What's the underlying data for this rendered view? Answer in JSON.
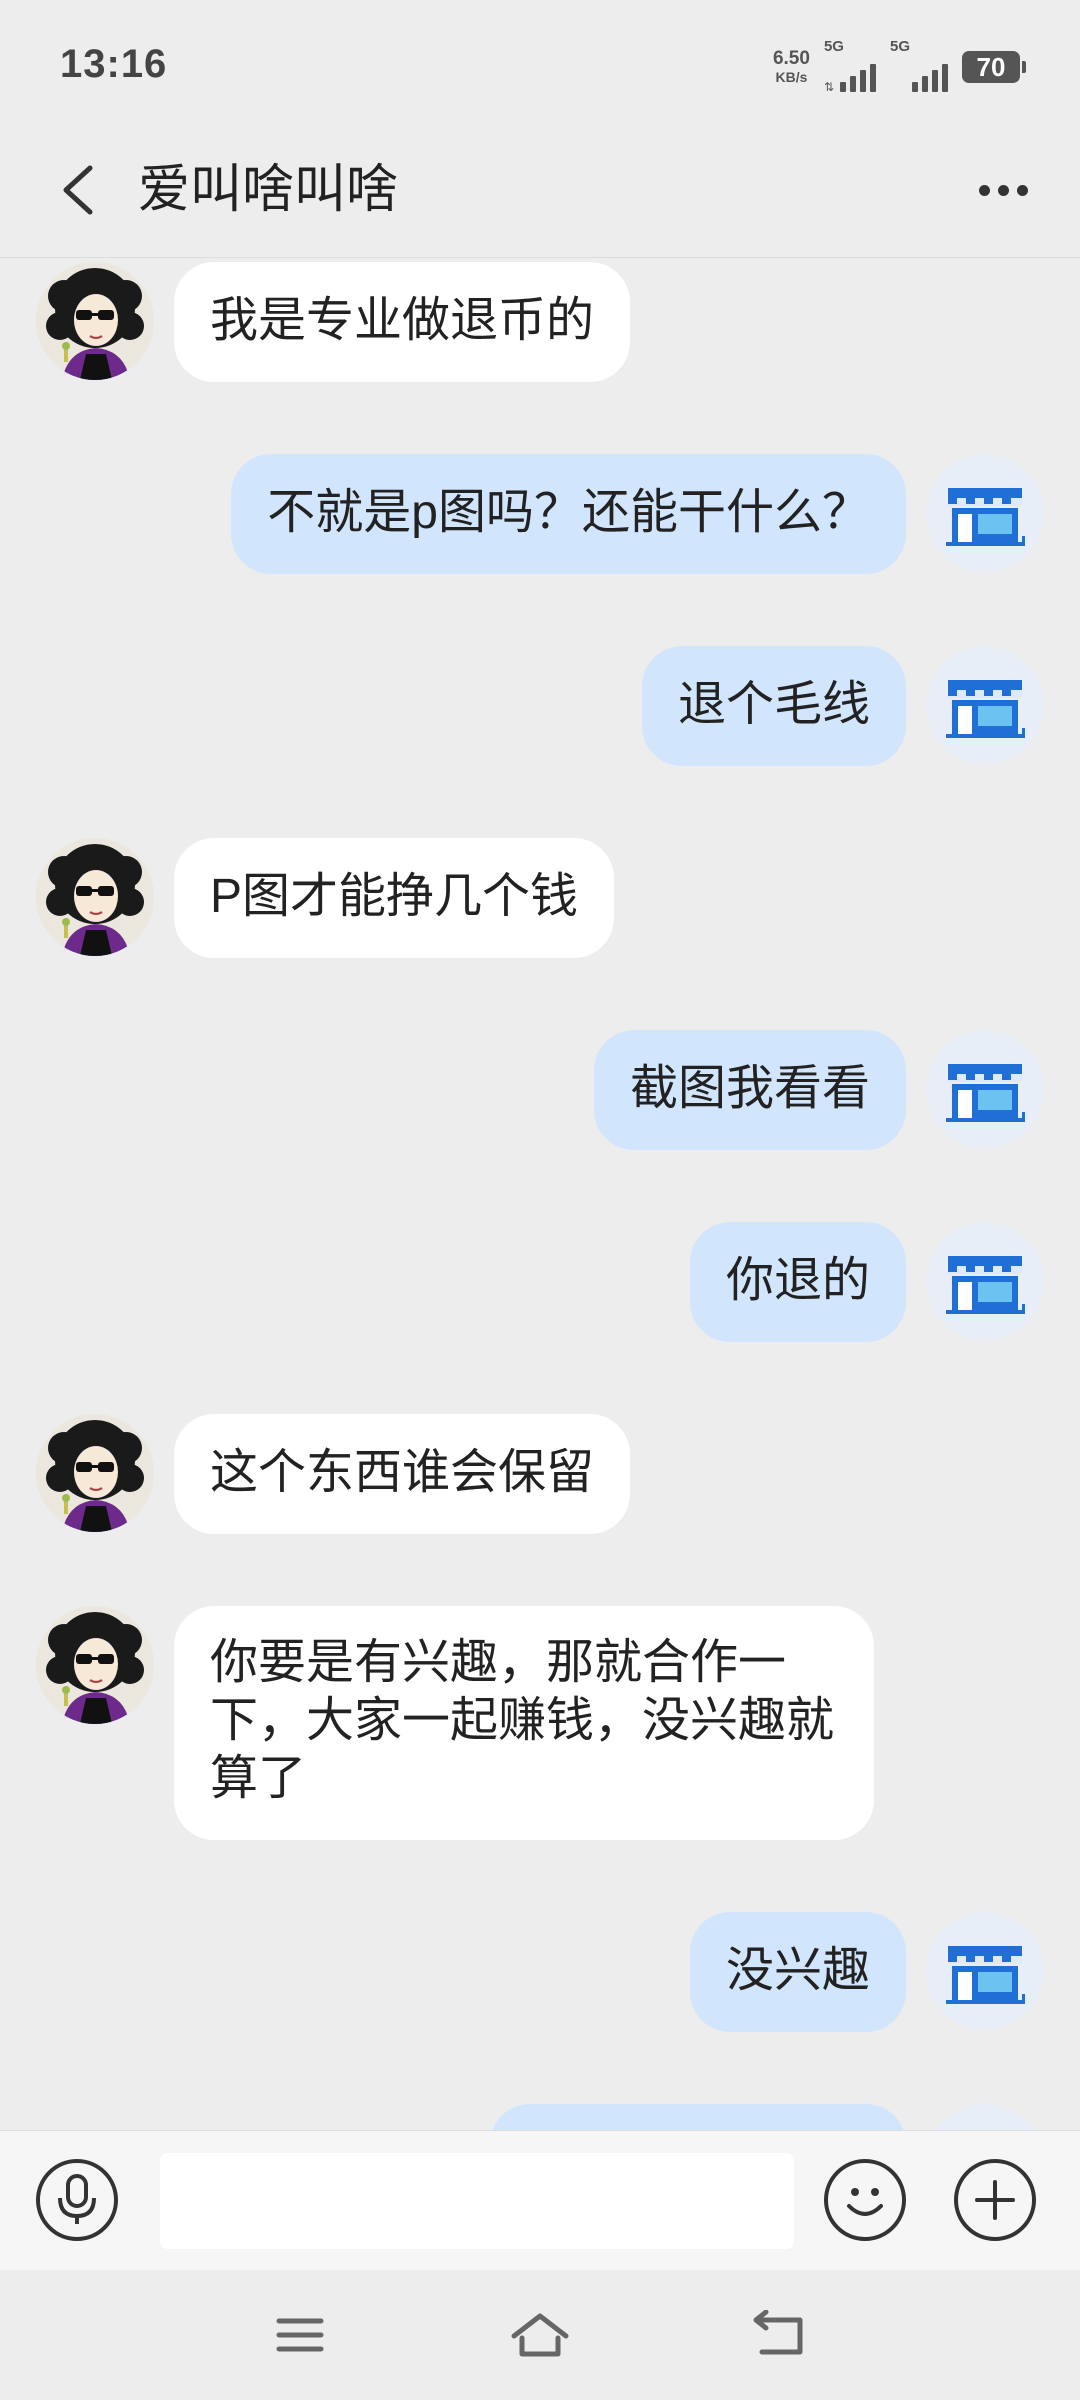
{
  "status_bar": {
    "time": "13:16",
    "net_speed": "6.50",
    "net_speed_unit": "KB/s",
    "sim1_label": "5G",
    "sim2_label": "5G",
    "battery": "70"
  },
  "header": {
    "title": "爱叫啥叫啥"
  },
  "messages": [
    {
      "side": "left",
      "text": "我是专业做退币的"
    },
    {
      "side": "right",
      "text": "不就是p图吗？还能干什么？"
    },
    {
      "side": "right",
      "text": "退个毛线"
    },
    {
      "side": "left",
      "text": "P图才能挣几个钱"
    },
    {
      "side": "right",
      "text": "截图我看看"
    },
    {
      "side": "right",
      "text": "你退的"
    },
    {
      "side": "left",
      "text": "这个东西谁会保留"
    },
    {
      "side": "left",
      "text": "你要是有兴趣，那就合作一下，大家一起赚钱，没兴趣就算了"
    },
    {
      "side": "right",
      "text": "没兴趣"
    },
    {
      "side": "right",
      "text": ""
    }
  ],
  "input": {
    "value": "",
    "placeholder": ""
  },
  "icons": {
    "back": "chevron-left-icon",
    "more": "more-dots-icon",
    "voice": "microphone-icon",
    "emoji": "smiley-icon",
    "plus": "plus-icon",
    "nav_menu": "menu-icon",
    "nav_home": "home-icon",
    "nav_back": "back-icon",
    "contact_avatar": "cartoon-avatar",
    "self_avatar": "shop-store-icon"
  },
  "colors": {
    "background": "#ededed",
    "bubble_left": "#ffffff",
    "bubble_right": "#d1e5fc",
    "store_blue": "#1f6fd6"
  }
}
